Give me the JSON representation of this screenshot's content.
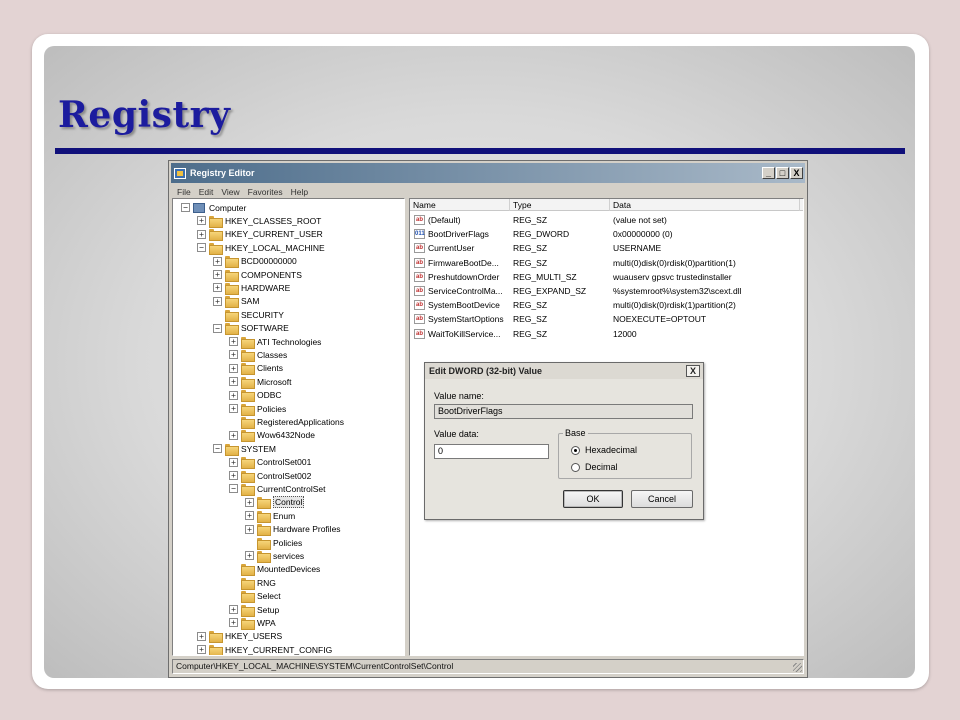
{
  "slide": {
    "title": "Registry"
  },
  "window": {
    "title": "Registry Editor",
    "controls": {
      "minimize": "_",
      "maximize": "□",
      "close": "X"
    },
    "menu": [
      "File",
      "Edit",
      "View",
      "Favorites",
      "Help"
    ]
  },
  "tree": [
    {
      "label": "Computer",
      "depth": 0,
      "expander": "−",
      "icon": "computer-icon"
    },
    {
      "label": "HKEY_CLASSES_ROOT",
      "depth": 1,
      "expander": "+"
    },
    {
      "label": "HKEY_CURRENT_USER",
      "depth": 1,
      "expander": "+"
    },
    {
      "label": "HKEY_LOCAL_MACHINE",
      "depth": 1,
      "expander": "−"
    },
    {
      "label": "BCD00000000",
      "depth": 2,
      "expander": "+"
    },
    {
      "label": "COMPONENTS",
      "depth": 2,
      "expander": "+"
    },
    {
      "label": "HARDWARE",
      "depth": 2,
      "expander": "+"
    },
    {
      "label": "SAM",
      "depth": 2,
      "expander": "+"
    },
    {
      "label": "SECURITY",
      "depth": 2,
      "expander": ""
    },
    {
      "label": "SOFTWARE",
      "depth": 2,
      "expander": "−"
    },
    {
      "label": "ATI Technologies",
      "depth": 3,
      "expander": "+"
    },
    {
      "label": "Classes",
      "depth": 3,
      "expander": "+"
    },
    {
      "label": "Clients",
      "depth": 3,
      "expander": "+"
    },
    {
      "label": "Microsoft",
      "depth": 3,
      "expander": "+"
    },
    {
      "label": "ODBC",
      "depth": 3,
      "expander": "+"
    },
    {
      "label": "Policies",
      "depth": 3,
      "expander": "+"
    },
    {
      "label": "RegisteredApplications",
      "depth": 3,
      "expander": ""
    },
    {
      "label": "Wow6432Node",
      "depth": 3,
      "expander": "+"
    },
    {
      "label": "SYSTEM",
      "depth": 2,
      "expander": "−"
    },
    {
      "label": "ControlSet001",
      "depth": 3,
      "expander": "+"
    },
    {
      "label": "ControlSet002",
      "depth": 3,
      "expander": "+"
    },
    {
      "label": "CurrentControlSet",
      "depth": 3,
      "expander": "−"
    },
    {
      "label": "Control",
      "depth": 4,
      "expander": "+",
      "selected": true
    },
    {
      "label": "Enum",
      "depth": 4,
      "expander": "+"
    },
    {
      "label": "Hardware Profiles",
      "depth": 4,
      "expander": "+"
    },
    {
      "label": "Policies",
      "depth": 4,
      "expander": ""
    },
    {
      "label": "services",
      "depth": 4,
      "expander": "+"
    },
    {
      "label": "MountedDevices",
      "depth": 3,
      "expander": ""
    },
    {
      "label": "RNG",
      "depth": 3,
      "expander": ""
    },
    {
      "label": "Select",
      "depth": 3,
      "expander": ""
    },
    {
      "label": "Setup",
      "depth": 3,
      "expander": "+"
    },
    {
      "label": "WPA",
      "depth": 3,
      "expander": "+"
    },
    {
      "label": "HKEY_USERS",
      "depth": 1,
      "expander": "+"
    },
    {
      "label": "HKEY_CURRENT_CONFIG",
      "depth": 1,
      "expander": "+"
    }
  ],
  "list": {
    "columns": [
      "Name",
      "Type",
      "Data"
    ],
    "rows": [
      {
        "icon": "ab",
        "name": "(Default)",
        "type": "REG_SZ",
        "data": "(value not set)"
      },
      {
        "icon": "011",
        "name": "BootDriverFlags",
        "type": "REG_DWORD",
        "data": "0x00000000 (0)"
      },
      {
        "icon": "ab",
        "name": "CurrentUser",
        "type": "REG_SZ",
        "data": "USERNAME"
      },
      {
        "icon": "ab",
        "name": "FirmwareBootDe...",
        "type": "REG_SZ",
        "data": "multi(0)disk(0)rdisk(0)partition(1)"
      },
      {
        "icon": "ab",
        "name": "PreshutdownOrder",
        "type": "REG_MULTI_SZ",
        "data": "wuauserv gpsvc trustedinstaller"
      },
      {
        "icon": "ab",
        "name": "ServiceControlMa...",
        "type": "REG_EXPAND_SZ",
        "data": "%systemroot%\\system32\\scext.dll"
      },
      {
        "icon": "ab",
        "name": "SystemBootDevice",
        "type": "REG_SZ",
        "data": "multi(0)disk(0)rdisk(1)partition(2)"
      },
      {
        "icon": "ab",
        "name": "SystemStartOptions",
        "type": "REG_SZ",
        "data": " NOEXECUTE=OPTOUT"
      },
      {
        "icon": "ab",
        "name": "WaitToKillService...",
        "type": "REG_SZ",
        "data": "12000"
      }
    ]
  },
  "statusbar": {
    "path": "Computer\\HKEY_LOCAL_MACHINE\\SYSTEM\\CurrentControlSet\\Control"
  },
  "dialog": {
    "title": "Edit DWORD (32-bit) Value",
    "close": "X",
    "value_name_label": "Value name:",
    "value_name": "BootDriverFlags",
    "value_data_label": "Value data:",
    "value_data": "0",
    "base_label": "Base",
    "base_options": [
      {
        "label": "Hexadecimal",
        "selected": true
      },
      {
        "label": "Decimal",
        "selected": false
      }
    ],
    "ok_label": "OK",
    "cancel_label": "Cancel"
  }
}
